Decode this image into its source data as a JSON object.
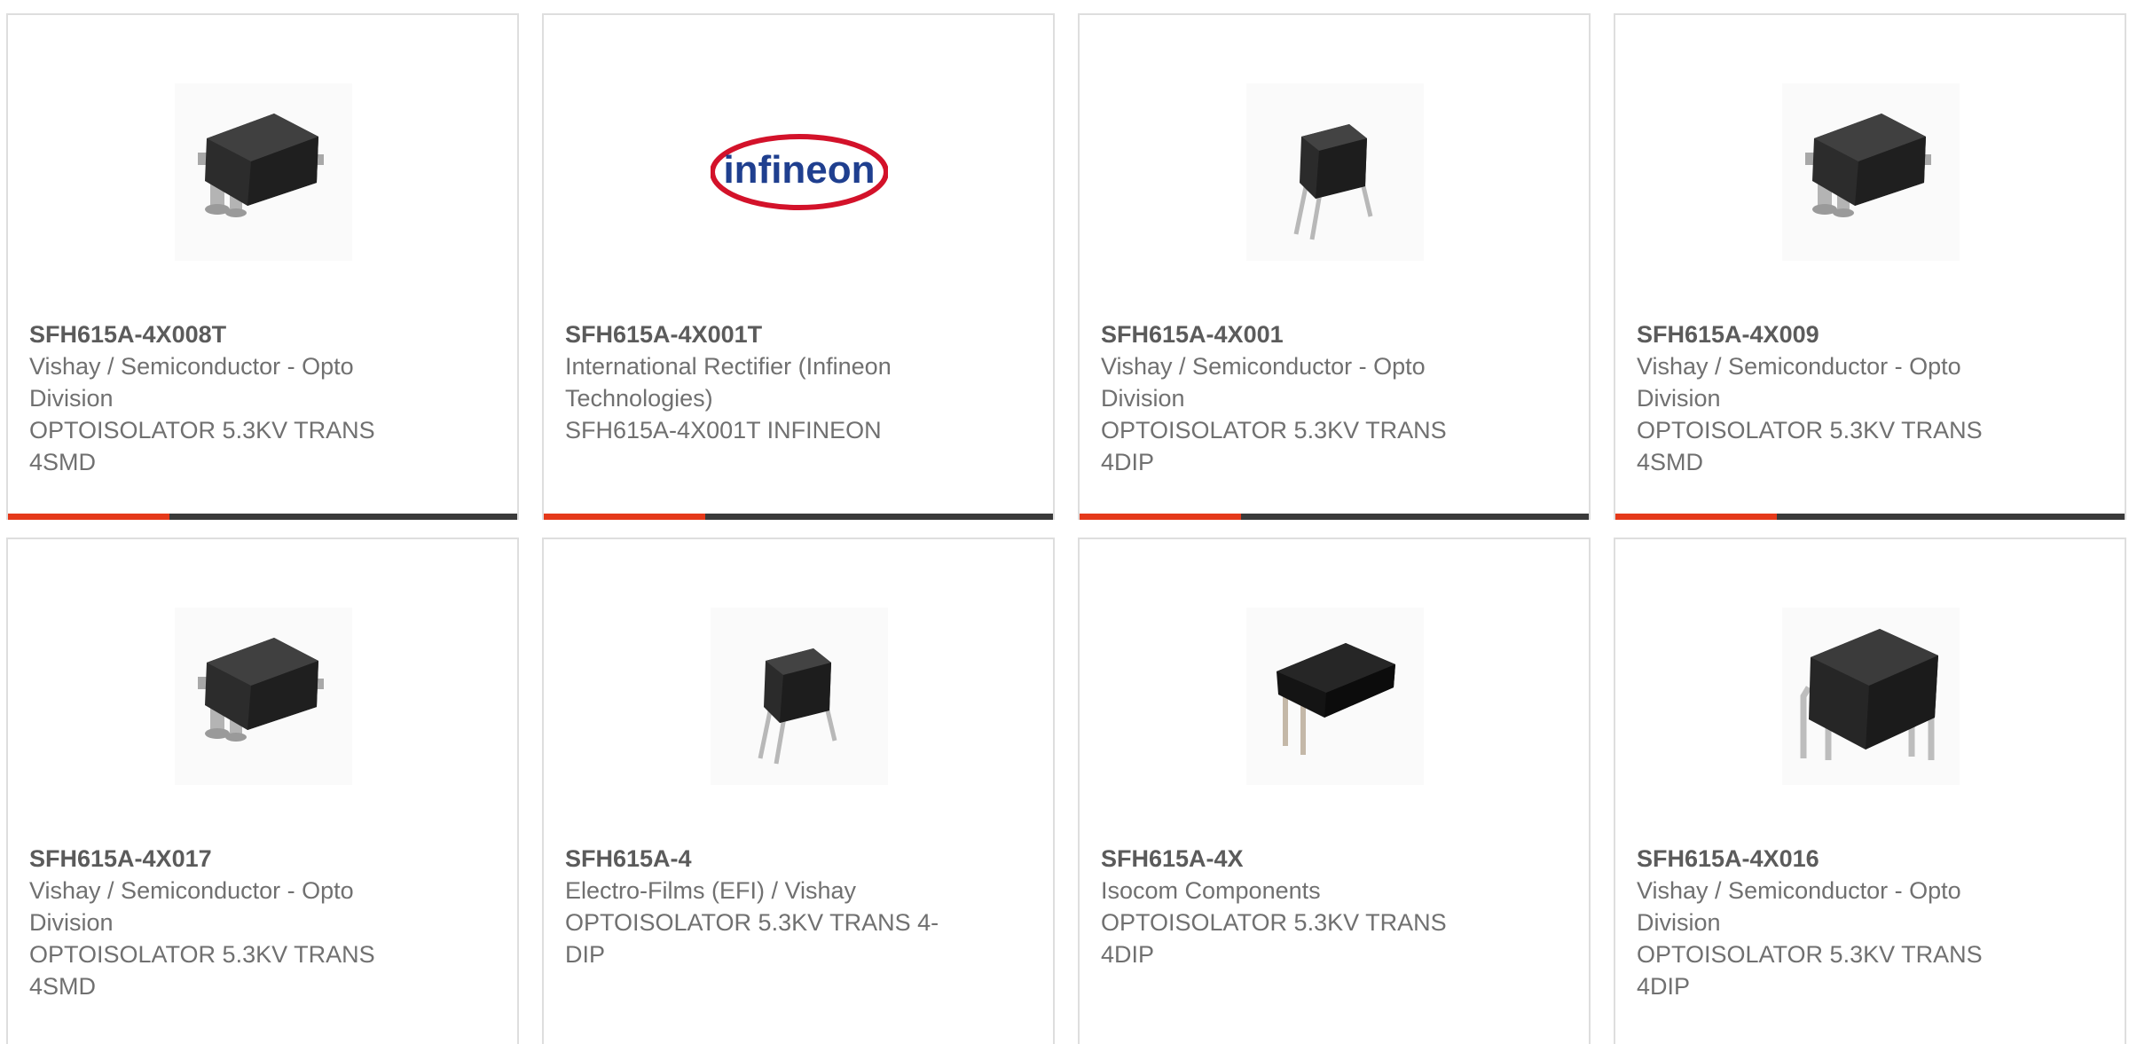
{
  "colors": {
    "accent": "#e5391a",
    "bar": "#3a3a3a",
    "border": "#dedede",
    "text": "#707070",
    "title": "#5b5b5b"
  },
  "products": [
    {
      "part": "SFH615A-4X008T",
      "manufacturer": "Vishay / Semiconductor - Opto Division",
      "description": "OPTOISOLATOR 5.3KV TRANS 4SMD",
      "image": "smd-package-image"
    },
    {
      "part": "SFH615A-4X001T",
      "manufacturer": "International Rectifier (Infineon Technologies)",
      "description": "SFH615A-4X001T INFINEON",
      "image": "infineon-logo",
      "logo_text": "infineon"
    },
    {
      "part": "SFH615A-4X001",
      "manufacturer": "Vishay / Semiconductor - Opto Division",
      "description": "OPTOISOLATOR 5.3KV TRANS 4DIP",
      "image": "dip-package-image"
    },
    {
      "part": "SFH615A-4X009",
      "manufacturer": "Vishay / Semiconductor - Opto Division",
      "description": "OPTOISOLATOR 5.3KV TRANS 4SMD",
      "image": "smd-package-image"
    },
    {
      "part": "SFH615A-4X017",
      "manufacturer": "Vishay / Semiconductor - Opto Division",
      "description": "OPTOISOLATOR 5.3KV TRANS 4SMD",
      "image": "smd-package-image"
    },
    {
      "part": "SFH615A-4",
      "manufacturer": "Electro-Films (EFI) / Vishay",
      "description": "OPTOISOLATOR 5.3KV TRANS 4-DIP",
      "image": "dip-package-image"
    },
    {
      "part": "SFH615A-4X",
      "manufacturer": "Isocom Components",
      "description": "OPTOISOLATOR 5.3KV TRANS 4DIP",
      "image": "dip-package-black-image"
    },
    {
      "part": "SFH615A-4X016",
      "manufacturer": "Vishay / Semiconductor - Opto Division",
      "description": "OPTOISOLATOR 5.3KV TRANS 4DIP",
      "image": "dip-package-large-image"
    }
  ]
}
